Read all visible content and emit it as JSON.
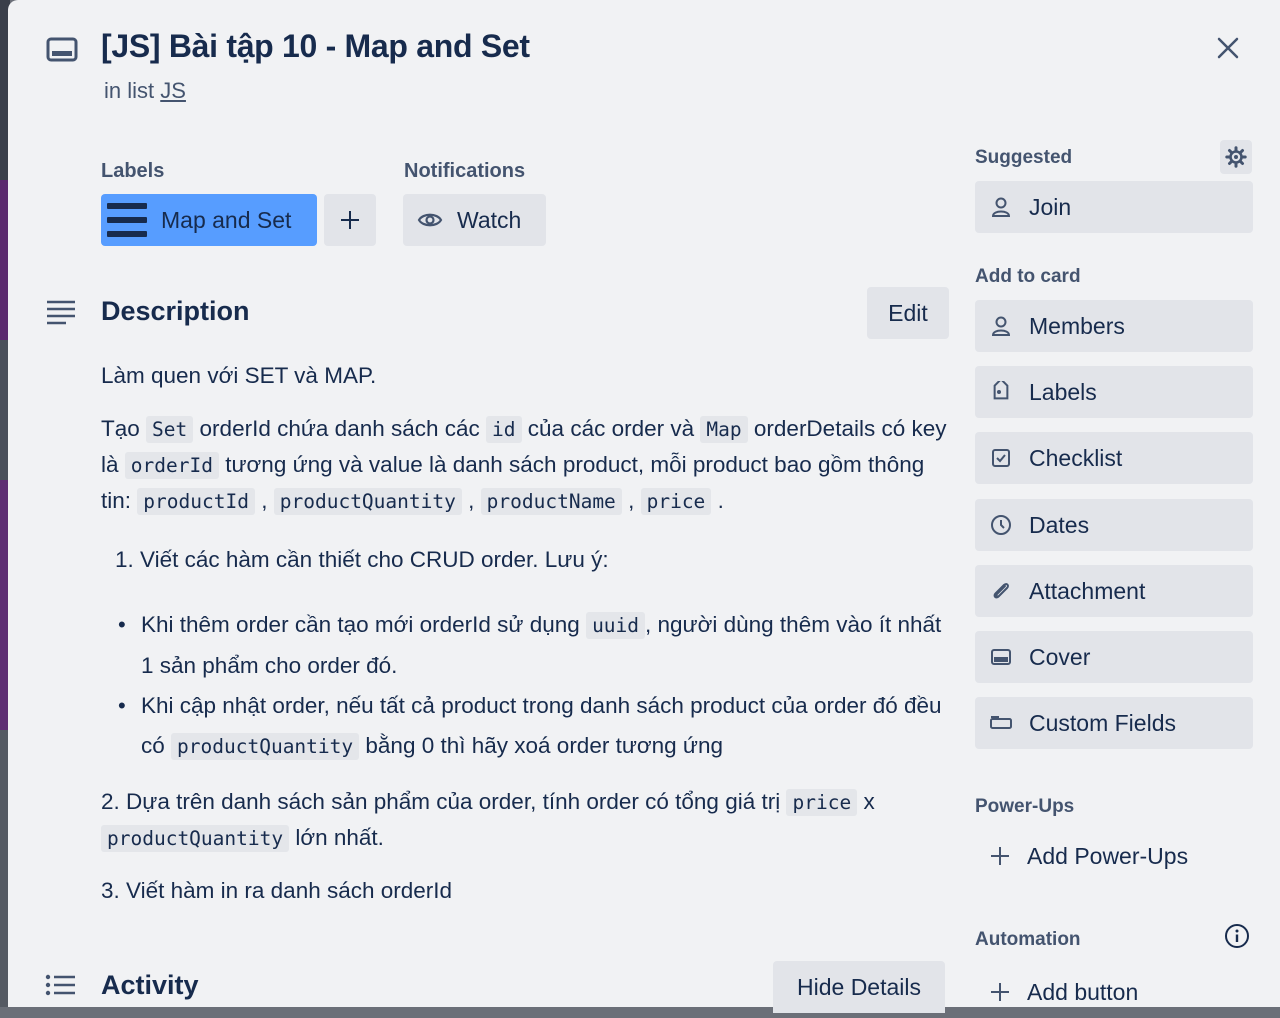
{
  "card": {
    "title": "[JS] Bài tập 10 - Map and Set",
    "in_list_prefix": "in list",
    "list_name": "JS"
  },
  "labels": {
    "heading": "Labels",
    "items": [
      "Map and Set"
    ],
    "label_color": "#579dff"
  },
  "notifications": {
    "heading": "Notifications",
    "watch_label": "Watch"
  },
  "description": {
    "heading": "Description",
    "edit_label": "Edit",
    "p1": "Làm quen với SET và MAP.",
    "p2": {
      "t1": "Tạo",
      "c1": "Set",
      "t2": "orderId chứa danh sách các",
      "c2": "id",
      "t3": "của các order và",
      "c3": "Map",
      "t4": "orderDetails có key là",
      "c4": "orderId",
      "t5": "tương ứng và value là danh sách product, mỗi product bao gồm thông tin:",
      "c5": "productId",
      "sep1": ",",
      "c6": "productQuantity",
      "sep2": ",",
      "c7": "productName",
      "sep3": ",",
      "c8": "price",
      "end": "."
    },
    "o1": "1. Viết các hàm cần thiết cho CRUD order. Lưu ý:",
    "b1": {
      "t1": "Khi thêm order cần tạo mới orderId sử dụng",
      "c1": "uuid",
      "t2": ", người dùng thêm vào ít nhất 1 sản phẩm cho order đó."
    },
    "b2": {
      "t1": "Khi cập nhật order, nếu tất cả product trong danh sách product của order đó đều có",
      "c1": "productQuantity",
      "t2": "bằng 0 thì hãy xoá order tương ứng"
    },
    "o2": {
      "t1": "2. Dựa trên danh sách sản phẩm của order, tính order có tổng giá trị",
      "c1": "price",
      "t2": "x",
      "c2": "productQuantity",
      "t3": "lớn nhất."
    },
    "o3": "3. Viết hàm in ra danh sách orderId"
  },
  "activity": {
    "heading": "Activity",
    "hide_details_label": "Hide Details"
  },
  "sidebar": {
    "suggested_heading": "Suggested",
    "join_label": "Join",
    "add_to_card_heading": "Add to card",
    "add_to_card": [
      {
        "label": "Members",
        "icon": "person-icon"
      },
      {
        "label": "Labels",
        "icon": "tag-icon"
      },
      {
        "label": "Checklist",
        "icon": "checkbox-icon"
      },
      {
        "label": "Dates",
        "icon": "clock-icon"
      },
      {
        "label": "Attachment",
        "icon": "paperclip-icon"
      },
      {
        "label": "Cover",
        "icon": "card-cover-icon"
      },
      {
        "label": "Custom Fields",
        "icon": "custom-fields-icon"
      }
    ],
    "power_ups_heading": "Power-Ups",
    "add_power_ups_label": "Add Power-Ups",
    "automation_heading": "Automation",
    "add_button_label": "Add button"
  }
}
